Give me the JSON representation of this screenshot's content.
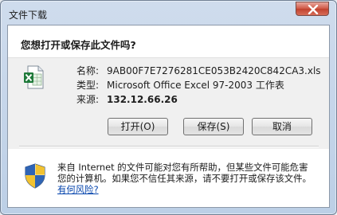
{
  "window": {
    "title": "文件下载"
  },
  "dialog": {
    "question": "您想打开或保存此文件吗?",
    "file_icon": "excel-file-icon",
    "fields": {
      "name_label": "名称:",
      "name_value": "9AB00F7E7276281CE053B2420C842CA3.xls",
      "type_label": "类型:",
      "type_value": "Microsoft Office Excel 97-2003 工作表",
      "from_label": "来源:",
      "from_value": "132.12.66.26"
    },
    "buttons": {
      "open": "打开(O)",
      "save": "保存(S)",
      "cancel": "取消"
    },
    "warning": {
      "icon": "shield-icon",
      "text": "来自 Internet 的文件可能对您有所帮助，但某些文件可能危害您的计算机。如果您不信任其来源，请不要打开或保存该文件。",
      "link": "有何风险?"
    }
  },
  "colors": {
    "frame": "#bccfe6",
    "close_button": "#c0412e",
    "link": "#0645ad"
  }
}
